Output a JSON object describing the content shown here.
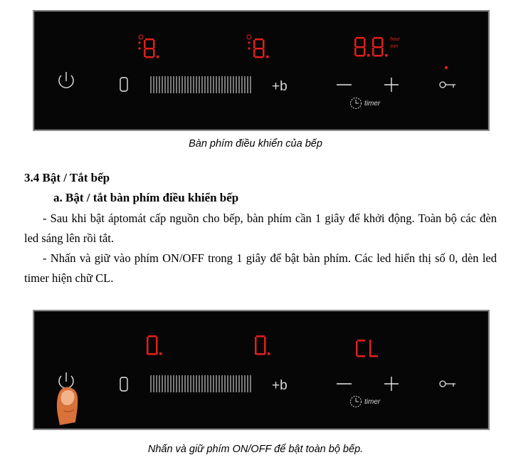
{
  "panel1": {
    "zone1_display": "8.",
    "zone2_display": "8.",
    "timer_display": "8.8.",
    "hour_label": "hour",
    "min_label": "min",
    "boost_label": "+b",
    "zero_label": "0",
    "timer_label": "timer",
    "minus_label": "—",
    "plus_label": "+"
  },
  "caption1": "Bàn phím điều khiển của bếp",
  "section_heading": "3.4 Bật /  Tắt bếp",
  "subheading": "a. Bật / tắt bàn phím điều khiển bếp",
  "paragraph1": "- Sau khi bật áptomát cấp nguồn cho bếp, bàn phím cần 1 giây để khởi động. Toàn bộ các đèn led sáng lên rồi tắt.",
  "paragraph2": "- Nhấn và giữ vào phím ON/OFF trong 1 giây để bật bàn phím. Các led hiển thị số 0, dèn led timer hiện chữ CL.",
  "panel2": {
    "zone1_display": "0.",
    "zone2_display": "0.",
    "timer_display": "CL",
    "boost_label": "+b",
    "zero_label": "0",
    "timer_label": "timer"
  },
  "caption2": "Nhấn và giữ phím ON/OFF để bật  toàn bộ bếp."
}
